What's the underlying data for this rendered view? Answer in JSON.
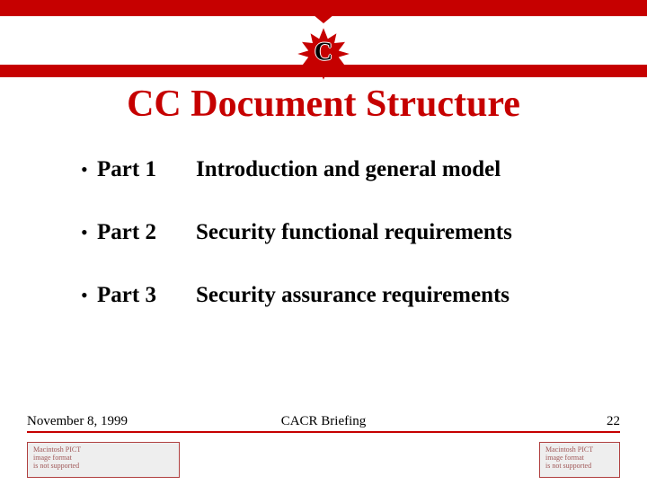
{
  "logo_label": "C",
  "title": "CC Document Structure",
  "items": [
    {
      "part": "Part 1",
      "desc": "Introduction and general model"
    },
    {
      "part": "Part 2",
      "desc": "Security functional requirements"
    },
    {
      "part": "Part 3",
      "desc": "Security assurance requirements"
    }
  ],
  "footer": {
    "date": "November 8, 1999",
    "center": "CACR Briefing",
    "page": "22"
  },
  "placeholder_text": "Macintosh PICT\nimage format\nis not supported"
}
